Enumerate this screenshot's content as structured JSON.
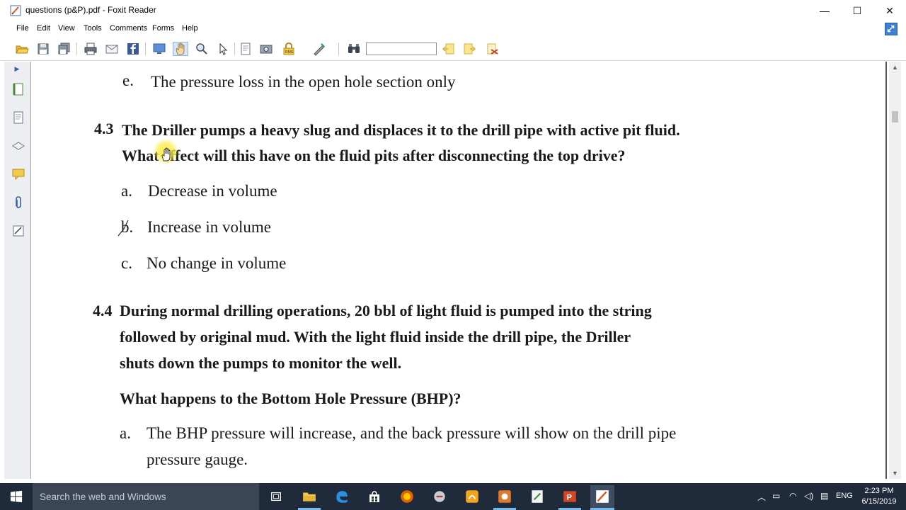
{
  "window": {
    "title": "questions  (p&P).pdf - Foxit Reader",
    "minimize": "—",
    "maximize": "☐",
    "close": "✕"
  },
  "menu": {
    "items": [
      "File",
      "Edit",
      "View",
      "Tools",
      "Comments",
      "Forms",
      "Help"
    ]
  },
  "toolbar": {
    "find_value": "",
    "icons": [
      "open-icon",
      "save-icon",
      "save-all-icon",
      "print-icon",
      "email-icon",
      "facebook-icon",
      "screen-icon",
      "hand-icon",
      "zoom-icon",
      "select-icon",
      "text-select-icon",
      "snapshot-icon",
      "rms-icon",
      "pen-icon",
      "binoculars-icon",
      "find-prev-icon",
      "find-next-icon",
      "find-options-icon"
    ]
  },
  "document": {
    "line_e": "e.",
    "line_e_text": "The pressure loss in the open hole section only",
    "q43_num": "4.3",
    "q43_line1": "The Driller pumps a heavy slug and displaces it to the drill pipe with active pit fluid.",
    "q43_line2": "What effect will this have on the fluid pits after disconnecting the top drive?",
    "q43_a_label": "a.",
    "q43_a": "Decrease in volume",
    "q43_b_label": "b.",
    "q43_b": "Increase in volume",
    "q43_c_label": "c.",
    "q43_c": "No change in volume",
    "q44_num": "4.4",
    "q44_line1": "During normal drilling operations, 20 bbl of light fluid is pumped into the string",
    "q44_line2": "followed by original mud. With the light fluid inside the drill pipe, the Driller",
    "q44_line3": "shuts down the pumps to monitor the well.",
    "q44_question": "What happens to the Bottom Hole Pressure (BHP)?",
    "q44_a_label": "a.",
    "q44_a_line1": "The BHP pressure will increase, and the back pressure will show on the drill pipe",
    "q44_a_line2": "pressure gauge."
  },
  "taskbar": {
    "search_placeholder": "Search the web and Windows",
    "language": "ENG",
    "time": "2:23 PM",
    "date": "6/15/2019"
  }
}
